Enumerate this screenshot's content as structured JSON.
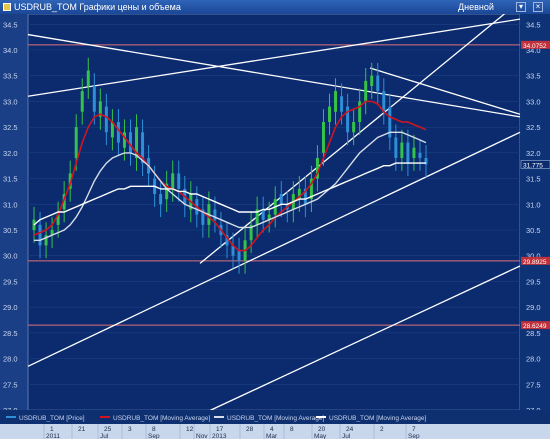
{
  "window": {
    "title": "USDRUB_TOM Графики цены и объема",
    "timeframe": "Дневной",
    "close_icon": "close-icon",
    "menu_icon": "chevron-down-icon"
  },
  "chart_data": {
    "type": "line",
    "title": "",
    "ylim": [
      27.0,
      34.7
    ],
    "y_ticks": [
      "34.5",
      "34.0",
      "33.5",
      "33.0",
      "32.5",
      "32.0",
      "31.5",
      "31.0",
      "30.5",
      "30.0",
      "29.5",
      "29.0",
      "28.5",
      "28.0",
      "27.5",
      "27.0"
    ],
    "x_ticks": [
      {
        "label": "1",
        "sub": "2011"
      },
      {
        "label": "21",
        "sub": ""
      },
      {
        "label": "25",
        "sub": "Jul"
      },
      {
        "label": "3",
        "sub": ""
      },
      {
        "label": "8",
        "sub": "Sep"
      },
      {
        "label": "12",
        "sub": ""
      },
      {
        "label": "",
        "sub": "Nov"
      },
      {
        "label": "17",
        "sub": "2013"
      },
      {
        "label": "28",
        "sub": ""
      },
      {
        "label": "4",
        "sub": "Mar"
      },
      {
        "label": "8",
        "sub": ""
      },
      {
        "label": "20",
        "sub": "May"
      },
      {
        "label": "24",
        "sub": "Jul"
      },
      {
        "label": "2",
        "sub": ""
      },
      {
        "label": "7",
        "sub": "Sep"
      }
    ],
    "last_price": "31.775",
    "price_markers": [
      "34.0752",
      "29.8925",
      "28.6249"
    ],
    "horizontal_levels": [
      34.1,
      29.9,
      28.65
    ],
    "legend": [
      {
        "name": "USDRUB_TOM [Price]",
        "color": "#2e8fd6"
      },
      {
        "name": "USDRUB_TOM [Moving Average]",
        "color": "#d21420"
      },
      {
        "name": "USDRUB_TOM [Moving Average]",
        "color": "#d6dde8"
      },
      {
        "name": "USDRUB_TOM [Moving Average]",
        "color": "#ffffff"
      }
    ],
    "x": [
      0,
      4,
      8,
      12,
      16,
      20,
      24,
      28,
      32,
      36,
      40,
      44,
      48,
      52,
      56,
      60,
      64,
      68,
      72,
      76,
      80,
      84,
      88,
      92,
      96,
      100,
      104,
      108,
      112,
      116,
      120,
      124,
      128,
      132,
      136,
      140,
      144,
      148,
      152,
      156,
      160,
      164,
      168,
      172,
      176,
      180,
      184,
      188,
      192,
      196,
      200,
      204,
      208,
      212,
      216,
      220,
      224,
      228,
      232,
      236,
      240,
      244,
      248,
      252,
      256,
      260,
      264,
      268,
      272,
      276,
      280,
      284,
      288,
      292,
      296,
      300,
      304,
      308,
      312,
      316,
      320,
      324,
      328,
      332,
      336,
      340,
      344,
      348,
      352,
      356,
      360,
      364,
      368,
      372,
      376,
      380,
      384,
      388,
      392,
      396,
      400
    ],
    "series": [
      {
        "type": "candles",
        "color": "#2e8fd6",
        "close": [
          30.7,
          30.2,
          30.4,
          30.5,
          30.8,
          31.2,
          31.6,
          32.5,
          33.2,
          33.6,
          32.8,
          33.0,
          32.4,
          32.6,
          32.2,
          32.4,
          32.0,
          32.5,
          31.8,
          31.6,
          31.2,
          31.0,
          31.4,
          31.6,
          31.3,
          31.0,
          31.2,
          30.8,
          30.6,
          31.0,
          30.7,
          30.4,
          30.2,
          30.0,
          29.9,
          30.3,
          30.6,
          30.9,
          30.7,
          30.8,
          31.1,
          31.0,
          30.9,
          31.2,
          31.3,
          31.0,
          31.5,
          31.9,
          32.6,
          32.9,
          33.2,
          32.8,
          32.4,
          32.6,
          33.0,
          33.4,
          33.5,
          33.2,
          32.8,
          32.3,
          31.9,
          32.2,
          31.8,
          32.1,
          31.9,
          31.775
        ],
        "open": [
          30.5,
          30.6,
          30.2,
          30.4,
          30.6,
          30.9,
          31.3,
          31.9,
          32.8,
          33.3,
          33.3,
          32.7,
          32.9,
          32.3,
          32.6,
          32.1,
          32.4,
          31.9,
          32.4,
          31.9,
          31.5,
          31.2,
          31.1,
          31.3,
          31.6,
          31.3,
          30.9,
          31.1,
          30.9,
          30.6,
          30.9,
          30.6,
          30.4,
          30.2,
          30.1,
          29.9,
          30.3,
          30.6,
          30.9,
          30.7,
          30.8,
          31.2,
          31.0,
          30.9,
          31.1,
          31.3,
          31.1,
          31.5,
          32.0,
          32.6,
          32.8,
          33.1,
          32.9,
          32.4,
          32.6,
          33.0,
          33.3,
          33.5,
          33.2,
          32.9,
          32.3,
          31.9,
          32.2,
          31.9,
          32.0,
          31.9
        ]
      },
      {
        "name": "USDRUB_TOM [Moving Average]",
        "color": "#d21420",
        "values": [
          30.4,
          30.45,
          30.5,
          30.6,
          30.8,
          31.1,
          31.4,
          31.8,
          32.2,
          32.5,
          32.7,
          32.75,
          32.7,
          32.6,
          32.45,
          32.3,
          32.15,
          32.0,
          31.9,
          31.75,
          31.6,
          31.45,
          31.35,
          31.3,
          31.25,
          31.15,
          31.05,
          30.95,
          30.85,
          30.75,
          30.65,
          30.5,
          30.35,
          30.2,
          30.1,
          30.1,
          30.2,
          30.35,
          30.5,
          30.6,
          30.75,
          30.85,
          30.95,
          31.05,
          31.15,
          31.25,
          31.4,
          31.6,
          31.9,
          32.2,
          32.5,
          32.7,
          32.8,
          32.85,
          32.9,
          33.0,
          33.0,
          32.95,
          32.8,
          32.7,
          32.65,
          32.6,
          32.6,
          32.55,
          32.5,
          32.45
        ]
      },
      {
        "name": "USDRUB_TOM [Moving Average]",
        "color": "#d6dde8",
        "values": [
          30.3,
          30.3,
          30.35,
          30.4,
          30.45,
          30.5,
          30.6,
          30.75,
          30.95,
          31.2,
          31.45,
          31.65,
          31.8,
          31.9,
          31.95,
          32.0,
          32.0,
          31.95,
          31.85,
          31.75,
          31.6,
          31.45,
          31.3,
          31.2,
          31.1,
          31.0,
          30.95,
          30.9,
          30.85,
          30.8,
          30.75,
          30.7,
          30.65,
          30.6,
          30.55,
          30.55,
          30.55,
          30.6,
          30.65,
          30.7,
          30.75,
          30.8,
          30.85,
          30.9,
          30.95,
          31.0,
          31.05,
          31.1,
          31.2,
          31.3,
          31.4,
          31.55,
          31.7,
          31.85,
          32.0,
          32.1,
          32.2,
          32.3,
          32.35,
          32.4,
          32.4,
          32.4,
          32.35,
          32.3,
          32.25,
          32.2
        ]
      },
      {
        "name": "USDRUB_TOM [Moving Average]",
        "color": "#ffffff",
        "values": [
          30.6,
          30.7,
          30.75,
          30.8,
          30.85,
          30.85,
          30.9,
          30.95,
          31.0,
          31.05,
          31.1,
          31.15,
          31.2,
          31.25,
          31.3,
          31.3,
          31.35,
          31.35,
          31.35,
          31.35,
          31.35,
          31.3,
          31.3,
          31.3,
          31.25,
          31.25,
          31.2,
          31.2,
          31.15,
          31.1,
          31.05,
          31.0,
          30.95,
          30.9,
          30.85,
          30.85,
          30.85,
          30.85,
          30.9,
          30.9,
          30.95,
          31.0,
          31.0,
          31.05,
          31.1,
          31.1,
          31.15,
          31.2,
          31.25,
          31.3,
          31.35,
          31.4,
          31.45,
          31.5,
          31.55,
          31.6,
          31.65,
          31.7,
          31.75,
          31.75,
          31.8,
          31.8,
          31.8,
          31.8,
          31.8,
          31.8
        ]
      }
    ]
  }
}
